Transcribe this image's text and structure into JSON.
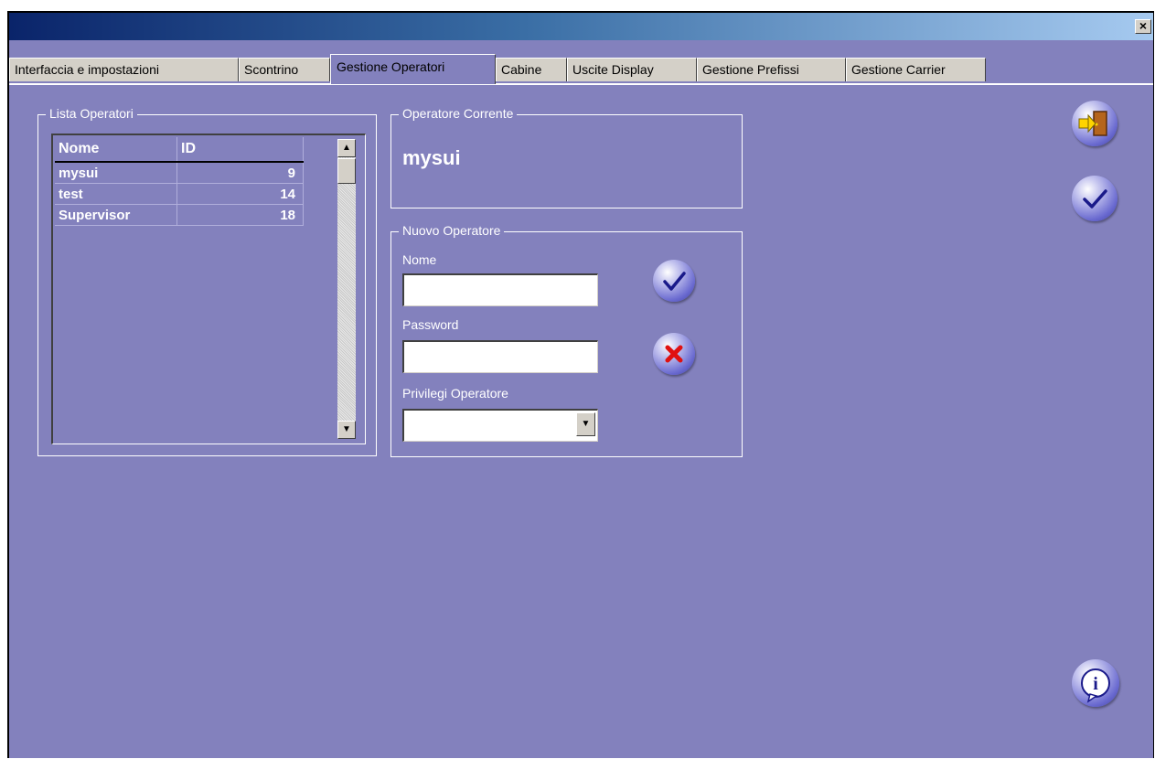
{
  "window": {
    "close_label": "×"
  },
  "tabs": [
    {
      "label": "Interfaccia  e impostazioni"
    },
    {
      "label": "Scontrino"
    },
    {
      "label": "Gestione Operatori"
    },
    {
      "label": "Cabine"
    },
    {
      "label": "Uscite Display"
    },
    {
      "label": "Gestione Prefissi"
    },
    {
      "label": "Gestione Carrier"
    }
  ],
  "active_tab": "Gestione Operatori",
  "lista_operatori": {
    "title": "Lista Operatori",
    "columns": [
      "Nome",
      "ID"
    ],
    "rows": [
      {
        "nome": "mysui",
        "id": "9"
      },
      {
        "nome": "test",
        "id": "14"
      },
      {
        "nome": "Supervisor",
        "id": "18"
      }
    ],
    "scroll_up": "▲",
    "scroll_down": "▼"
  },
  "operatore_corrente": {
    "title": "Operatore Corrente",
    "name": "mysui"
  },
  "nuovo_operatore": {
    "title": "Nuovo Operatore",
    "nome_label": "Nome",
    "nome_value": "",
    "password_label": "Password",
    "password_value": "",
    "privilegi_label": "Privilegi Operatore",
    "privilegi_value": "",
    "dropdown_arrow": "▼"
  },
  "icons": {
    "exit": "exit-door-icon",
    "confirm": "checkmark-icon",
    "cancel": "red-x-icon",
    "info": "info-icon"
  },
  "colors": {
    "background": "#8381bd",
    "title_gradient_start": "#0a246a",
    "title_gradient_end": "#a6caf0",
    "cancel_mark": "#e01010"
  }
}
